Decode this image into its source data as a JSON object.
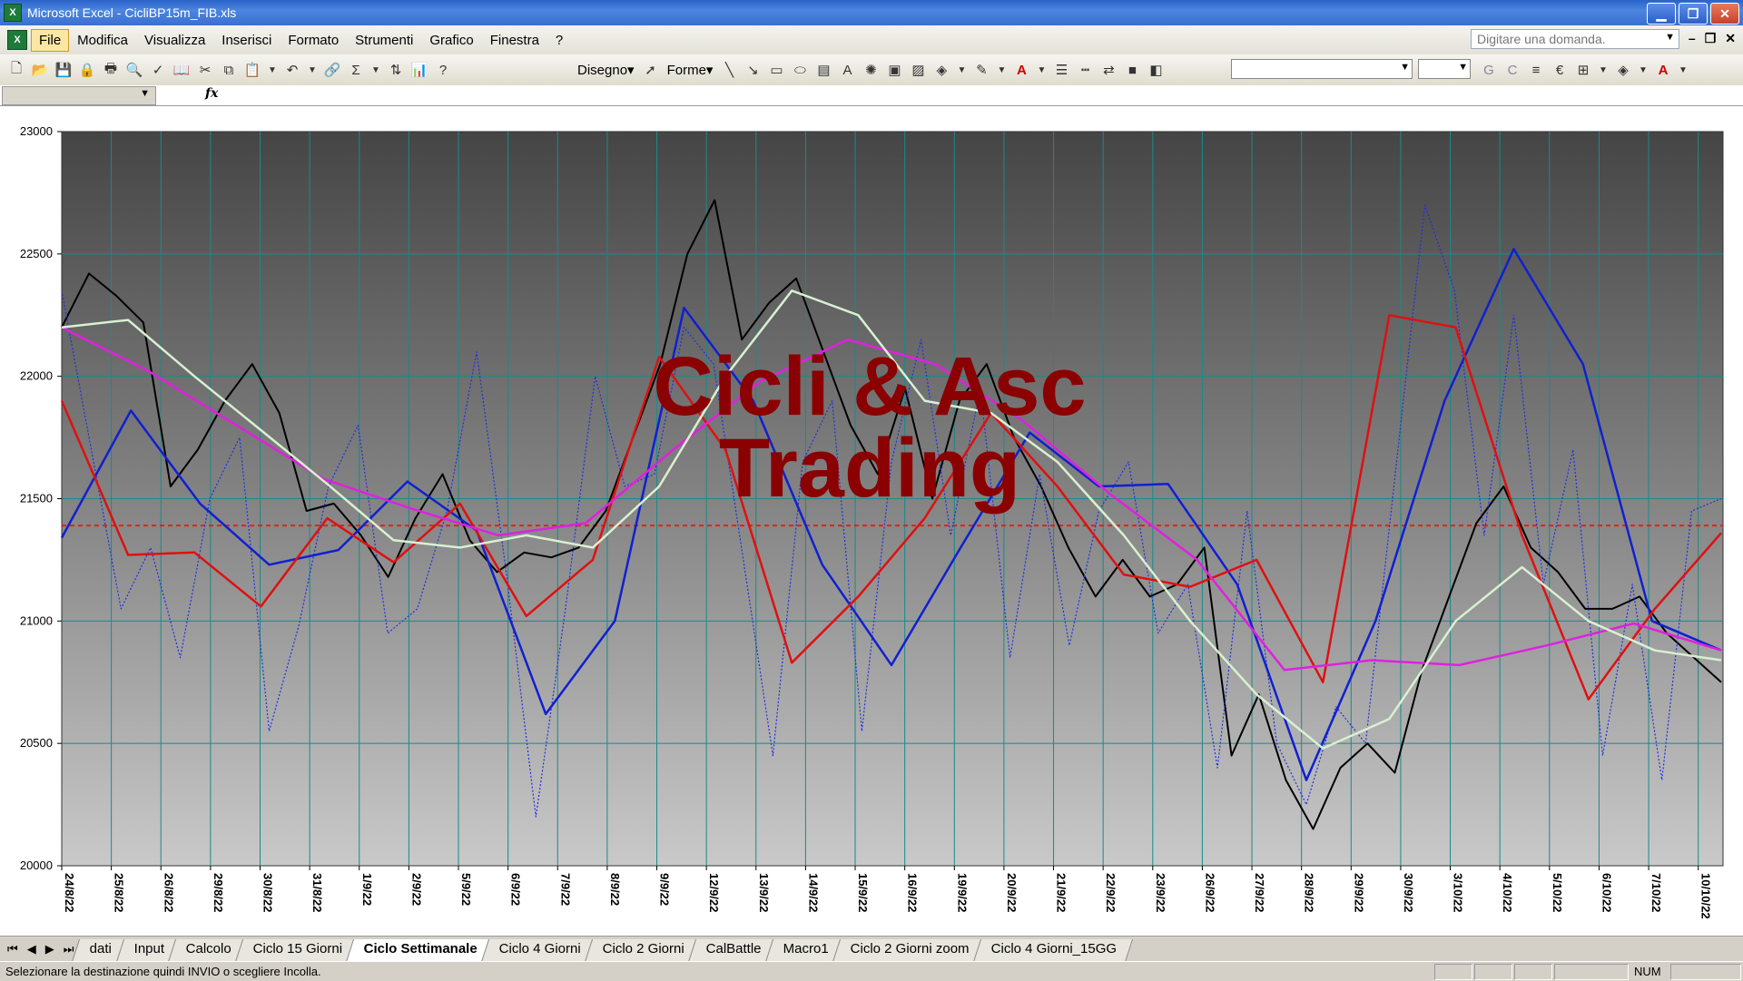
{
  "window": {
    "title": "Microsoft Excel - CicliBP15m_FIB.xls",
    "minimize": "▁",
    "maximize": "❐",
    "close": "✕"
  },
  "menubar": {
    "items": [
      "File",
      "Modifica",
      "Visualizza",
      "Inserisci",
      "Formato",
      "Strumenti",
      "Grafico",
      "Finestra",
      "?"
    ],
    "help_placeholder": "Digitare una domanda.",
    "doc_controls": [
      "–",
      "❐",
      "✕"
    ]
  },
  "toolbar": {
    "draw_label": "Disegno",
    "shapes_label": "Forme",
    "sigma": "Σ",
    "euro": "€"
  },
  "formula_bar": {
    "fx": "fx"
  },
  "chart_data": {
    "type": "line",
    "title": "",
    "watermark": [
      "Cicli & Asc",
      "Trading"
    ],
    "ylim": [
      20000,
      23000
    ],
    "y_ticks": [
      20000,
      20500,
      21000,
      21500,
      22000,
      22500,
      23000
    ],
    "x_labels": [
      "24/8/22",
      "25/8/22",
      "26/8/22",
      "29/8/22",
      "30/8/22",
      "31/8/22",
      "1/9/22",
      "2/9/22",
      "5/9/22",
      "6/9/22",
      "7/9/22",
      "8/9/22",
      "9/9/22",
      "12/9/22",
      "13/9/22",
      "14/9/22",
      "15/9/22",
      "16/9/22",
      "19/9/22",
      "20/9/22",
      "21/9/22",
      "22/9/22",
      "23/9/22",
      "26/9/22",
      "27/9/22",
      "28/9/22",
      "29/9/22",
      "30/9/22",
      "3/10/22",
      "4/10/22",
      "5/10/22",
      "6/10/22",
      "7/10/22",
      "10/10/22"
    ],
    "reference_line": {
      "value": 21390,
      "color": "#e02020",
      "style": "dashed"
    },
    "grid": true,
    "series": [
      {
        "color": "#000000",
        "style": "solid",
        "values": [
          22200,
          22420,
          22330,
          22220,
          21550,
          21700,
          21900,
          22050,
          21850,
          21450,
          21480,
          21350,
          21180,
          21420,
          21600,
          21330,
          21200,
          21280,
          21260,
          21300,
          21450,
          21750,
          22050,
          22500,
          22720,
          22150,
          22300,
          22400,
          22100,
          21800,
          21600,
          21950,
          21500,
          21900,
          22050,
          21750,
          21550,
          21300,
          21100,
          21250,
          21100,
          21150,
          21300,
          20450,
          20700,
          20350,
          20150,
          20400,
          20500,
          20380,
          20800,
          21100,
          21400,
          21550,
          21300,
          21200,
          21050,
          21050,
          21100,
          20950,
          20850,
          20750
        ]
      },
      {
        "color": "#2030e0",
        "style": "dotted",
        "values": [
          22350,
          21700,
          21050,
          21300,
          20850,
          21500,
          21750,
          20550,
          20980,
          21550,
          21800,
          20950,
          21050,
          21450,
          22100,
          21200,
          20200,
          21050,
          22000,
          21550,
          21600,
          22200,
          22050,
          21250,
          20450,
          21650,
          21900,
          20550,
          21650,
          22150,
          21350,
          21950,
          20850,
          21600,
          20900,
          21450,
          21650,
          20950,
          21150,
          20400,
          21450,
          20500,
          20250,
          20650,
          20500,
          21600,
          22700,
          22350,
          21350,
          22250,
          21150,
          21700,
          20450,
          21150,
          20350,
          21450,
          21500
        ]
      },
      {
        "color": "#1020d0",
        "style": "solid",
        "values": [
          21340,
          21860,
          21480,
          21230,
          21290,
          21570,
          21370,
          20620,
          21000,
          22280,
          21900,
          21230,
          20820,
          21300,
          21770,
          21550,
          21560,
          21150,
          20350,
          21000,
          21900,
          22520,
          22050,
          21000,
          20880
        ]
      },
      {
        "color": "#e01010",
        "style": "solid",
        "values": [
          21900,
          21270,
          21280,
          21060,
          21420,
          21240,
          21480,
          21020,
          21250,
          22080,
          21700,
          20830,
          21100,
          21420,
          21850,
          21550,
          21190,
          21140,
          21250,
          20750,
          22250,
          22200,
          21350,
          20680,
          21050,
          21360
        ]
      },
      {
        "color": "#e020e0",
        "style": "solid",
        "values": [
          22200,
          22020,
          21800,
          21580,
          21460,
          21350,
          21400,
          21700,
          21980,
          22150,
          22050,
          21820,
          21520,
          21250,
          20800,
          20840,
          20820,
          20900,
          20990,
          20880
        ]
      },
      {
        "color": "#d8f0d0",
        "style": "solid",
        "values": [
          22200,
          22230,
          22000,
          21780,
          21560,
          21330,
          21300,
          21350,
          21300,
          21550,
          22000,
          22350,
          22250,
          21900,
          21850,
          21650,
          21350,
          21000,
          20700,
          20480,
          20600,
          21000,
          21220,
          21000,
          20880,
          20840
        ]
      }
    ]
  },
  "sheet_tabs": {
    "nav": [
      "⏮",
      "◀",
      "▶",
      "⏭"
    ],
    "tabs": [
      "dati",
      "Input",
      "Calcolo",
      "Ciclo 15 Giorni",
      "Ciclo Settimanale",
      "Ciclo 4 Giorni",
      "Ciclo 2 Giorni",
      "CalBattle",
      "Macro1",
      "Ciclo 2 Giorni zoom",
      "Ciclo 4 Giorni_15GG"
    ],
    "active_index": 4
  },
  "status": {
    "message": "Selezionare la destinazione quindi INVIO o scegliere Incolla.",
    "num": "NUM"
  }
}
